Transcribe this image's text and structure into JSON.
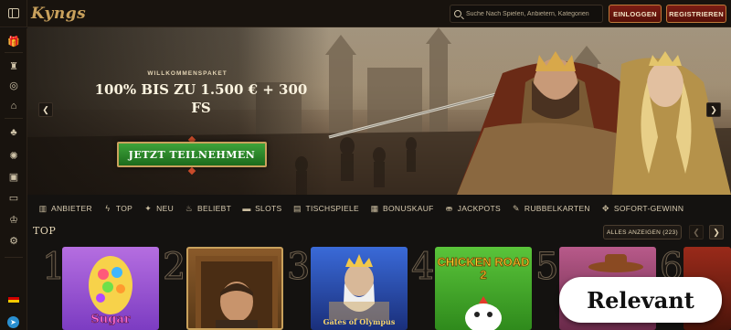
{
  "header": {
    "logo": "Kyngs",
    "search_placeholder": "Suche Nach Spielen, Anbietern, Kategorien",
    "login_label": "EINLOGGEN",
    "register_label": "REGISTRIEREN"
  },
  "sidebar": {
    "icons": [
      "gift-icon",
      "castle-icon",
      "casino-chip-icon",
      "shopping-bag-icon",
      "cards-icon",
      "roulette-icon",
      "live-casino-icon",
      "tv-icon",
      "trophy-icon",
      "settings-icon"
    ],
    "language_flag": "de-flag-icon",
    "social": "telegram-icon"
  },
  "hero": {
    "kicker": "WILLKOMMENSPAKET",
    "title": "100% BIS ZU 1.500 € + 300 FS",
    "cta": "JETZT TEILNEHMEN",
    "prev_icon": "chevron-left-icon",
    "next_icon": "chevron-right-icon"
  },
  "categories": [
    {
      "label": "ANBIETER",
      "icon": "provider-icon"
    },
    {
      "label": "TOP",
      "icon": "lightning-icon"
    },
    {
      "label": "NEU",
      "icon": "new-icon"
    },
    {
      "label": "BELIEBT",
      "icon": "flame-icon"
    },
    {
      "label": "SLOTS",
      "icon": "slots-icon"
    },
    {
      "label": "TISCHSPIELE",
      "icon": "table-icon"
    },
    {
      "label": "BONUSKAUF",
      "icon": "bonus-icon"
    },
    {
      "label": "JACKPOTS",
      "icon": "jackpot-icon"
    },
    {
      "label": "RUBBELKARTEN",
      "icon": "scratch-icon"
    },
    {
      "label": "SOFORT-GEWINN",
      "icon": "instant-win-icon"
    }
  ],
  "top": {
    "title": "TOP",
    "show_all": "ALLES ANZEIGEN (223)",
    "games": [
      {
        "rank": "1",
        "label": "Sugar"
      },
      {
        "rank": "2",
        "label": ""
      },
      {
        "rank": "3",
        "label": "Gates of Olympus"
      },
      {
        "rank": "4",
        "label": "CHICKEN ROAD 2"
      },
      {
        "rank": "5",
        "label": ""
      },
      {
        "rank": "6",
        "label": ""
      }
    ]
  },
  "overlay": {
    "badge": "Relevant"
  },
  "colors": {
    "accent_gold": "#c9a15c",
    "button_red": "#7b1d14",
    "cta_green": "#2f8a2c",
    "background": "#141210"
  }
}
